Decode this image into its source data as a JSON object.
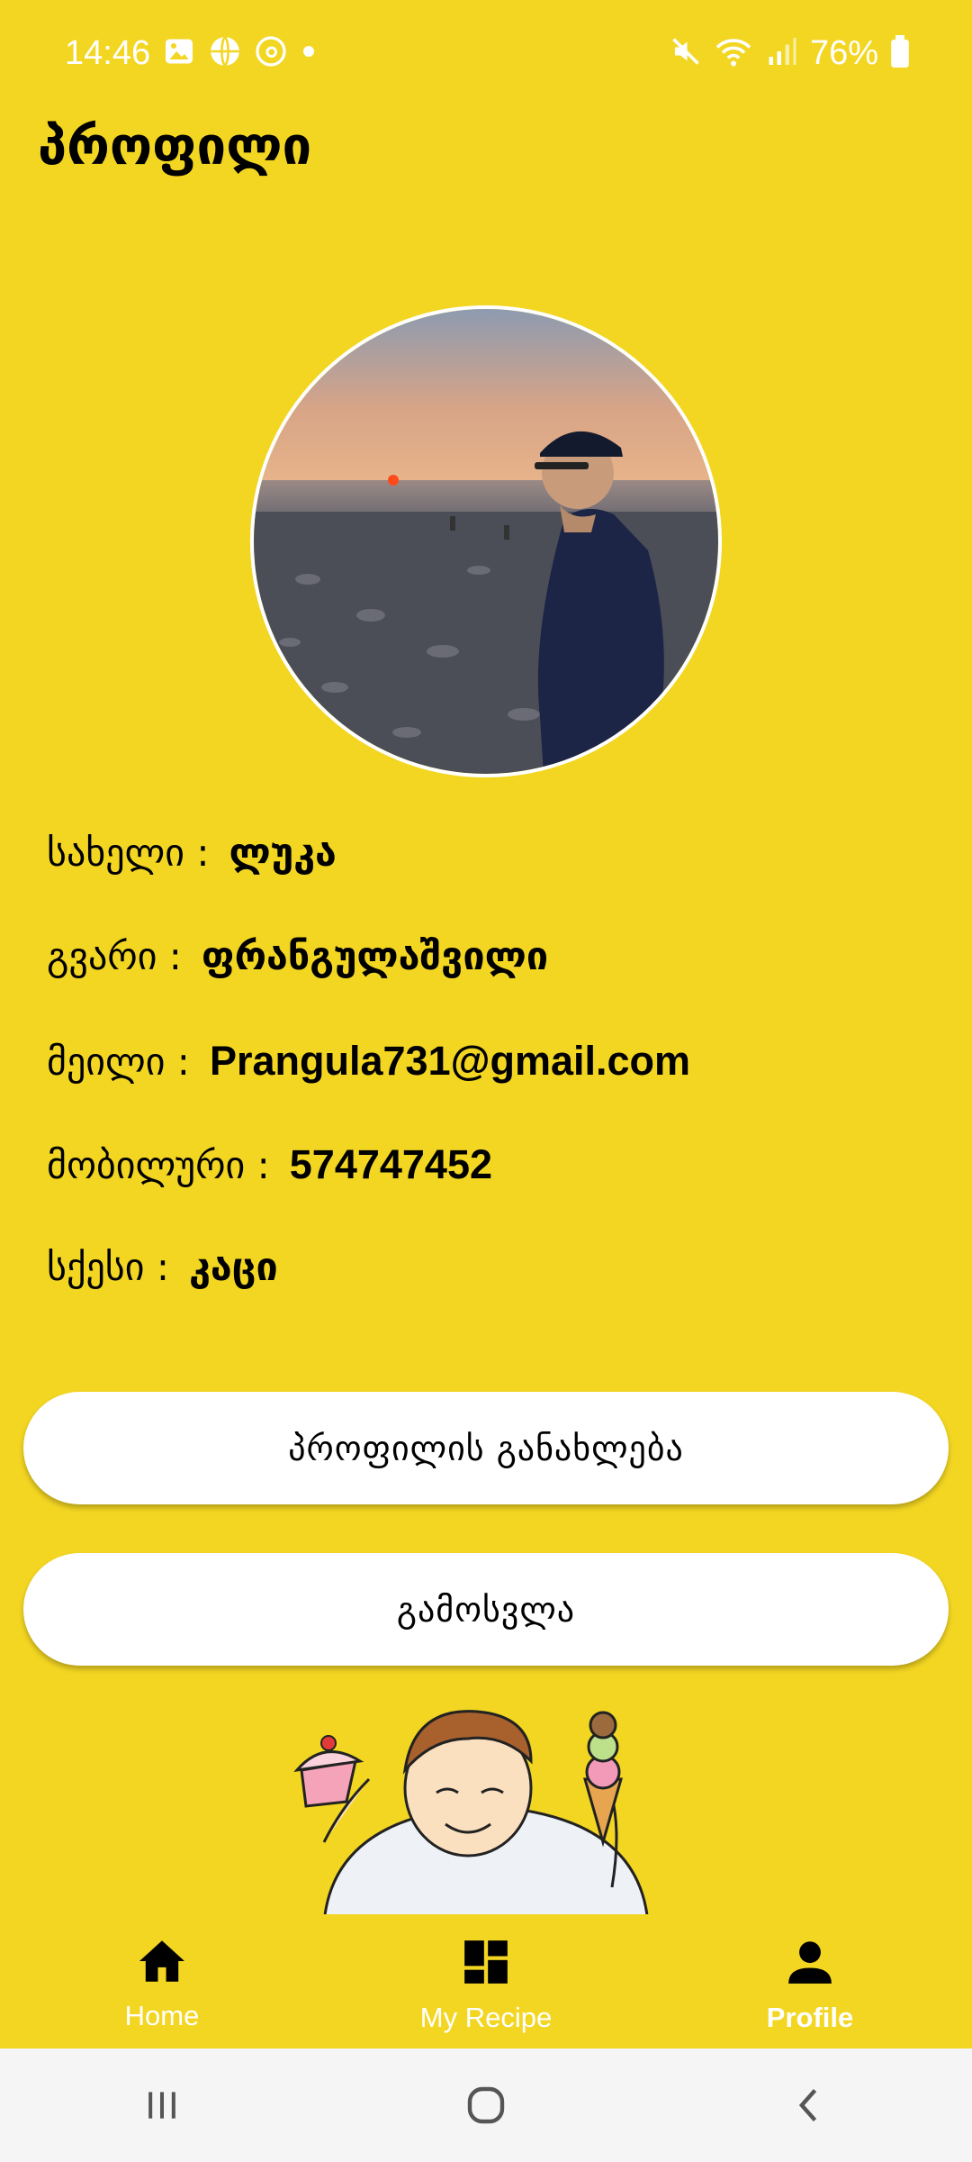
{
  "status_bar": {
    "time": "14:46",
    "battery": "76%",
    "icons": [
      "gallery-icon",
      "basketball-icon",
      "threads-icon",
      "dot-icon",
      "mute-icon",
      "wifi-icon",
      "signal-icon",
      "battery-icon"
    ]
  },
  "header": {
    "title": "პროფილი"
  },
  "profile": {
    "avatar_description": "avatar-photo",
    "fields": [
      {
        "label": "სახელი :",
        "value": "ლუკა"
      },
      {
        "label": "გვარი :",
        "value": "ფრანგულაშვილი"
      },
      {
        "label": "მეილი :",
        "value": "Prangula731@gmail.com"
      },
      {
        "label": "მობილური :",
        "value": "574747452"
      },
      {
        "label": "სქესი :",
        "value": "კაცი"
      }
    ]
  },
  "actions": {
    "update_label": "პროფილის განახლება",
    "logout_label": "გამოსვლა"
  },
  "bottom_nav": {
    "items": [
      {
        "label": "Home",
        "icon": "home-icon"
      },
      {
        "label": "My Recipe",
        "icon": "dashboard-icon"
      },
      {
        "label": "Profile",
        "icon": "person-icon",
        "active": true
      }
    ]
  },
  "colors": {
    "background": "#F3D622",
    "button_bg": "#FFFFFF",
    "nav_text": "#FFFFFF"
  }
}
